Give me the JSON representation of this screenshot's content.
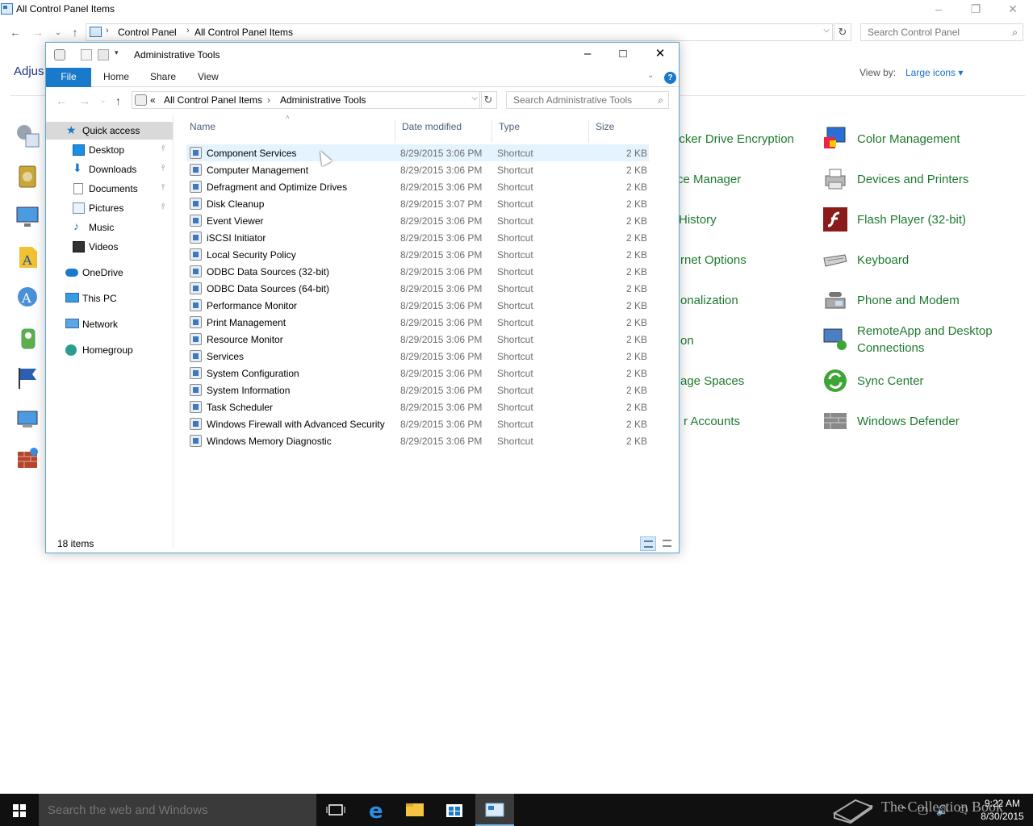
{
  "cp": {
    "title": "All Control Panel Items",
    "address": [
      "Control Panel",
      "All Control Panel Items"
    ],
    "search_placeholder": "Search Control Panel",
    "heading": "Adjus",
    "view_by_label": "View by:",
    "view_by_value": "Large icons",
    "items": [
      {
        "label": "ocker Drive Encryption",
        "icon": "bitlocker-icon",
        "color": "#7a7a7a"
      },
      {
        "label": "Color Management",
        "icon": "color-management-icon",
        "color": "#2a6fd6"
      },
      {
        "label": "ce Manager",
        "icon": "device-manager-icon",
        "color": "#7a7a7a"
      },
      {
        "label": "Devices and Printers",
        "icon": "printer-icon",
        "color": "#7a7a7a"
      },
      {
        "label": "History",
        "icon": "file-history-icon",
        "color": "#7a7a7a"
      },
      {
        "label": "Flash Player (32-bit)",
        "icon": "flash-icon",
        "color": "#8b1a1a"
      },
      {
        "label": "rnet Options",
        "icon": "internet-options-icon",
        "color": "#7a7a7a"
      },
      {
        "label": "Keyboard",
        "icon": "keyboard-icon",
        "color": "#888888"
      },
      {
        "label": "onalization",
        "icon": "personalization-icon",
        "color": "#7a7a7a"
      },
      {
        "label": "Phone and Modem",
        "icon": "phone-icon",
        "color": "#888888"
      },
      {
        "label": "on",
        "icon": "region-icon",
        "color": "#7a7a7a"
      },
      {
        "label": "RemoteApp and Desktop Connections",
        "icon": "remoteapp-icon",
        "color": "#4a7fc1"
      },
      {
        "label": "age Spaces",
        "icon": "storage-spaces-icon",
        "color": "#7a7a7a"
      },
      {
        "label": "Sync Center",
        "icon": "sync-icon",
        "color": "#3da534"
      },
      {
        "label": "r Accounts",
        "icon": "user-accounts-icon",
        "color": "#7a7a7a"
      },
      {
        "label": "Windows Defender",
        "icon": "defender-icon",
        "color": "#8a8a8a"
      }
    ]
  },
  "at": {
    "title": "Administrative Tools",
    "tabs": {
      "file": "File",
      "home": "Home",
      "share": "Share",
      "view": "View"
    },
    "address": [
      "All Control Panel Items",
      "Administrative Tools"
    ],
    "address_prefix": "«",
    "search_placeholder": "Search Administrative Tools",
    "nav": [
      {
        "label": "Quick access",
        "icon": "star-icon"
      },
      {
        "label": "Desktop",
        "icon": "desktop-icon"
      },
      {
        "label": "Downloads",
        "icon": "download-icon"
      },
      {
        "label": "Documents",
        "icon": "documents-icon"
      },
      {
        "label": "Pictures",
        "icon": "pictures-icon"
      },
      {
        "label": "Music",
        "icon": "music-icon"
      },
      {
        "label": "Videos",
        "icon": "videos-icon"
      },
      {
        "label": "OneDrive",
        "icon": "onedrive-icon"
      },
      {
        "label": "This PC",
        "icon": "pc-icon"
      },
      {
        "label": "Network",
        "icon": "network-icon"
      },
      {
        "label": "Homegroup",
        "icon": "homegroup-icon"
      }
    ],
    "columns": {
      "name": "Name",
      "date": "Date modified",
      "type": "Type",
      "size": "Size"
    },
    "rows": [
      {
        "name": "Component Services",
        "date": "8/29/2015 3:06 PM",
        "type": "Shortcut",
        "size": "2 KB"
      },
      {
        "name": "Computer Management",
        "date": "8/29/2015 3:06 PM",
        "type": "Shortcut",
        "size": "2 KB"
      },
      {
        "name": "Defragment and Optimize Drives",
        "date": "8/29/2015 3:06 PM",
        "type": "Shortcut",
        "size": "2 KB"
      },
      {
        "name": "Disk Cleanup",
        "date": "8/29/2015 3:07 PM",
        "type": "Shortcut",
        "size": "2 KB"
      },
      {
        "name": "Event Viewer",
        "date": "8/29/2015 3:06 PM",
        "type": "Shortcut",
        "size": "2 KB"
      },
      {
        "name": "iSCSI Initiator",
        "date": "8/29/2015 3:06 PM",
        "type": "Shortcut",
        "size": "2 KB"
      },
      {
        "name": "Local Security Policy",
        "date": "8/29/2015 3:06 PM",
        "type": "Shortcut",
        "size": "2 KB"
      },
      {
        "name": "ODBC Data Sources (32-bit)",
        "date": "8/29/2015 3:06 PM",
        "type": "Shortcut",
        "size": "2 KB"
      },
      {
        "name": "ODBC Data Sources (64-bit)",
        "date": "8/29/2015 3:06 PM",
        "type": "Shortcut",
        "size": "2 KB"
      },
      {
        "name": "Performance Monitor",
        "date": "8/29/2015 3:06 PM",
        "type": "Shortcut",
        "size": "2 KB"
      },
      {
        "name": "Print Management",
        "date": "8/29/2015 3:06 PM",
        "type": "Shortcut",
        "size": "2 KB"
      },
      {
        "name": "Resource Monitor",
        "date": "8/29/2015 3:06 PM",
        "type": "Shortcut",
        "size": "2 KB"
      },
      {
        "name": "Services",
        "date": "8/29/2015 3:06 PM",
        "type": "Shortcut",
        "size": "2 KB"
      },
      {
        "name": "System Configuration",
        "date": "8/29/2015 3:06 PM",
        "type": "Shortcut",
        "size": "2 KB"
      },
      {
        "name": "System Information",
        "date": "8/29/2015 3:06 PM",
        "type": "Shortcut",
        "size": "2 KB"
      },
      {
        "name": "Task Scheduler",
        "date": "8/29/2015 3:06 PM",
        "type": "Shortcut",
        "size": "2 KB"
      },
      {
        "name": "Windows Firewall with Advanced Security",
        "date": "8/29/2015 3:06 PM",
        "type": "Shortcut",
        "size": "2 KB"
      },
      {
        "name": "Windows Memory Diagnostic",
        "date": "8/29/2015 3:06 PM",
        "type": "Shortcut",
        "size": "2 KB"
      }
    ],
    "status": "18 items"
  },
  "taskbar": {
    "search_placeholder": "Search the web and Windows",
    "watermark": "The Collection Book",
    "time": "9:22 AM",
    "date": "8/30/2015"
  },
  "colors": {
    "accent": "#1979ca",
    "cp_link": "#1e7a2e",
    "taskbar": "#101010"
  }
}
